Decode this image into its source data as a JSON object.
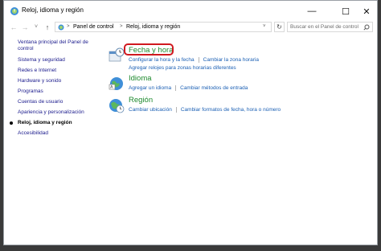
{
  "window": {
    "title": "Reloj, idioma y región",
    "minimize_glyph": "—",
    "maximize_glyph": "☐",
    "close_glyph": "✕"
  },
  "nav": {
    "back_glyph": "←",
    "forward_glyph": "→",
    "recent_glyph": "˅",
    "up_glyph": "↑",
    "breadcrumbs": [
      "Panel de control",
      "Reloj, idioma y región"
    ],
    "separator": ">",
    "dropdown_glyph": "˅",
    "refresh_glyph": "↻",
    "search_placeholder": "Buscar en el Panel de control"
  },
  "sidebar": {
    "items": [
      {
        "label": "Ventana principal del Panel de control",
        "current": false
      },
      {
        "label": "Sistema y seguridad",
        "current": false
      },
      {
        "label": "Redes e Internet",
        "current": false
      },
      {
        "label": "Hardware y sonido",
        "current": false
      },
      {
        "label": "Programas",
        "current": false
      },
      {
        "label": "Cuentas de usuario",
        "current": false
      },
      {
        "label": "Apariencia y personalización",
        "current": false
      },
      {
        "label": "Reloj, idioma y región",
        "current": true
      },
      {
        "label": "Accesibilidad",
        "current": false
      }
    ]
  },
  "categories": [
    {
      "title": "Fecha y hora",
      "icon": "clock-calendar-icon",
      "links": [
        [
          "Configurar la hora y la fecha",
          "Cambiar la zona horaria"
        ],
        [
          "Agregar relojes para zonas horarias diferentes"
        ]
      ]
    },
    {
      "title": "Idioma",
      "icon": "globe-language-icon",
      "links": [
        [
          "Agregar un idioma",
          "Cambiar métodos de entrada"
        ]
      ]
    },
    {
      "title": "Región",
      "icon": "globe-clock-icon",
      "links": [
        [
          "Cambiar ubicación",
          "Cambiar formatos de fecha, hora o número"
        ]
      ]
    }
  ],
  "colors": {
    "category_title": "#1e8a2e",
    "link": "#1a5fb4",
    "highlight": "#d0191f"
  }
}
